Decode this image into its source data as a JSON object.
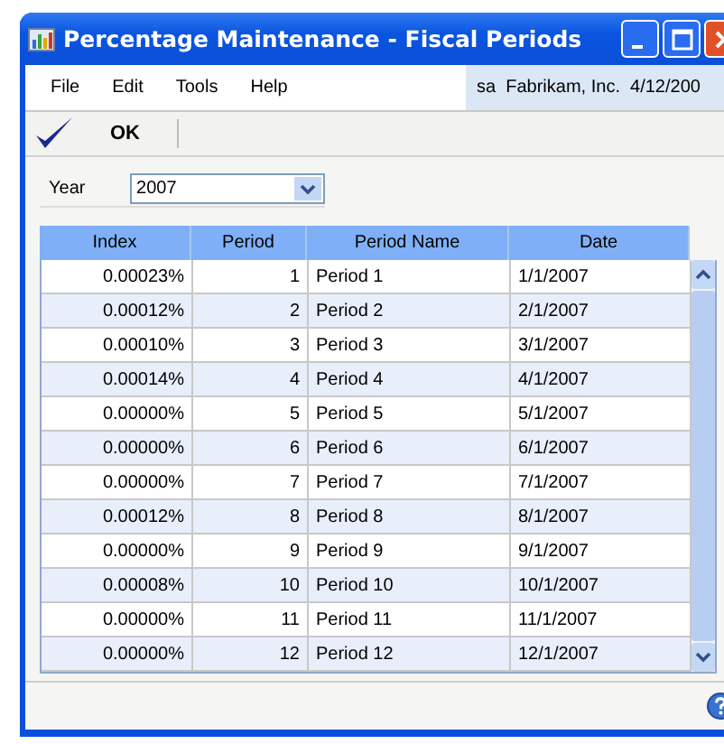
{
  "window": {
    "title": "Percentage Maintenance - Fiscal Periods"
  },
  "menu": [
    "File",
    "Edit",
    "Tools",
    "Help"
  ],
  "user_info": "sa  Fabrikam, Inc.  4/12/200",
  "toolbar": {
    "ok_label": "OK"
  },
  "year": {
    "label": "Year",
    "value": "2007"
  },
  "table": {
    "columns": [
      "Index",
      "Period",
      "Period Name",
      "Date"
    ],
    "rows": [
      {
        "index": "0.00023%",
        "period": "1",
        "name": "Period 1",
        "date": "1/1/2007"
      },
      {
        "index": "0.00012%",
        "period": "2",
        "name": "Period 2",
        "date": "2/1/2007"
      },
      {
        "index": "0.00010%",
        "period": "3",
        "name": "Period 3",
        "date": "3/1/2007"
      },
      {
        "index": "0.00014%",
        "period": "4",
        "name": "Period 4",
        "date": "4/1/2007"
      },
      {
        "index": "0.00000%",
        "period": "5",
        "name": "Period 5",
        "date": "5/1/2007"
      },
      {
        "index": "0.00000%",
        "period": "6",
        "name": "Period 6",
        "date": "6/1/2007"
      },
      {
        "index": "0.00000%",
        "period": "7",
        "name": "Period 7",
        "date": "7/1/2007"
      },
      {
        "index": "0.00012%",
        "period": "8",
        "name": "Period 8",
        "date": "8/1/2007"
      },
      {
        "index": "0.00000%",
        "period": "9",
        "name": "Period 9",
        "date": "9/1/2007"
      },
      {
        "index": "0.00008%",
        "period": "10",
        "name": "Period 10",
        "date": "10/1/2007"
      },
      {
        "index": "0.00000%",
        "period": "11",
        "name": "Period 11",
        "date": "11/1/2007"
      },
      {
        "index": "0.00000%",
        "period": "12",
        "name": "Period 12",
        "date": "12/1/2007"
      }
    ]
  }
}
